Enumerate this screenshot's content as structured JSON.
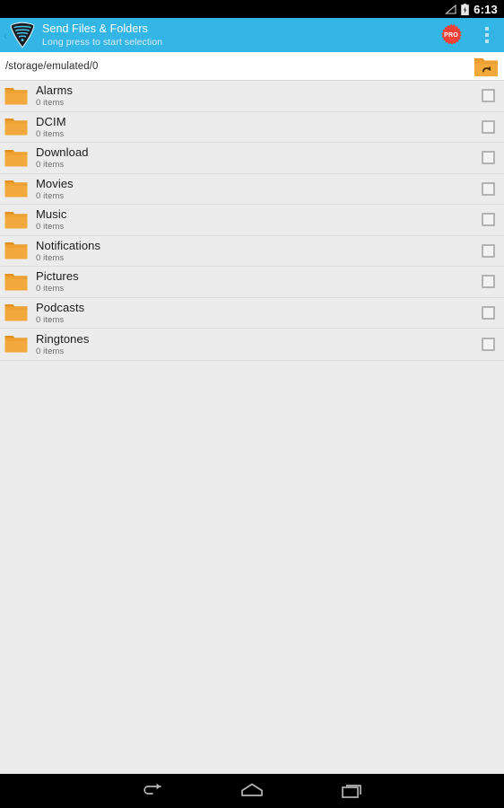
{
  "status_bar": {
    "time": "6:13",
    "signal_icon": "signal-triangle-icon",
    "battery_icon": "battery-icon"
  },
  "app_bar": {
    "back_chevron": "‹",
    "logo_icon": "superbeam-shield-wifi-logo",
    "title": "Send Files & Folders",
    "subtitle": "Long press to start selection",
    "pro_badge_label": "PRO",
    "overflow_icon": "overflow-menu-icon",
    "background_color": "#33b5e5"
  },
  "path_bar": {
    "path": "/storage/emulated/0",
    "up_button_icon": "folder-up-icon"
  },
  "file_list": {
    "item_icon": "folder-icon",
    "checkbox_icon": "checkbox-unchecked-icon",
    "items": [
      {
        "name": "Alarms",
        "info": "0 items"
      },
      {
        "name": "DCIM",
        "info": "0 items"
      },
      {
        "name": "Download",
        "info": "0 items"
      },
      {
        "name": "Movies",
        "info": "0 items"
      },
      {
        "name": "Music",
        "info": "0 items"
      },
      {
        "name": "Notifications",
        "info": "0 items"
      },
      {
        "name": "Pictures",
        "info": "0 items"
      },
      {
        "name": "Podcasts",
        "info": "0 items"
      },
      {
        "name": "Ringtones",
        "info": "0 items"
      }
    ]
  },
  "nav_bar": {
    "back_icon": "back-arrow-icon",
    "home_icon": "home-icon",
    "recents_icon": "recents-icon"
  }
}
